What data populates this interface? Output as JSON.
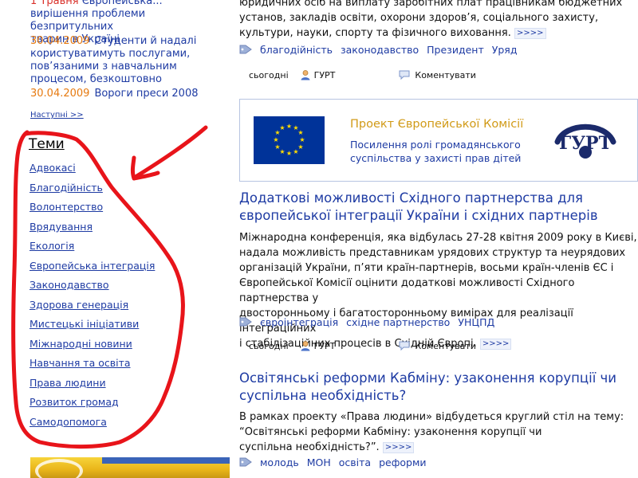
{
  "sidebar": {
    "news_top_1": "Європейська...",
    "news_top_red": "1 Травня",
    "news_top_2": "вирішення проблеми безпритульних",
    "news_top_3": "тварин в Україні",
    "news_items": [
      {
        "date": "30.04.2009",
        "text": "Студенти й надалі користуватимуть послугами, пов’язаними з навчальним процесом, безкоштовно"
      },
      {
        "date": "30.04.2009",
        "text": "Вороги преси 2008"
      }
    ],
    "next_label": "Наступні >>",
    "topics_title": "Теми",
    "topics": [
      "Адвокасі",
      "Благодійність",
      "Волонтерство",
      "Врядування",
      "Екологія",
      "Європейська інтеграція",
      "Законодавство",
      "Здорова генерація",
      "Мистецькі ініціативи",
      "Міжнародні новини",
      "Навчання та освіта",
      "Права людини",
      "Розвиток громад",
      "Самодопомога"
    ]
  },
  "article_top": {
    "text_line1": "юридичних осіб на виплату заробітних плат працівникам бюджетних",
    "text_line2": "установ, закладів освіти, охорони здоров’я, соціального захисту,",
    "text_line3": "культури, науки, спорту та фізичного виховання.",
    "more": ">>>>",
    "tags": [
      "благодійність",
      "законодавство",
      "Президент",
      "Уряд"
    ],
    "meta": {
      "date": "сьогодні",
      "author": "ГУРТ",
      "comment": "Коментувати"
    }
  },
  "banner": {
    "title": "Проект Європейської Комісії",
    "line1": "Посилення ролі громадянського",
    "line2": "суспільства у захисті прав дітей",
    "logo_text": "ГУРТ"
  },
  "article2": {
    "title_line1": "Додаткові можливості Східного партнерства для",
    "title_line2": "європейської інтеграції України і східних партнерів",
    "body_lines": [
      "Міжнародна конференція, яка відбулась 27-28 квітня 2009 року в Києві,",
      "надала можливість представникам урядових структур та неурядових",
      "організацій України, п’яти країн-партнерів, восьми країн-членів ЄС і",
      "Європейської Комісії оцінити додаткові можливості Східного партнерства у",
      "двосторонньому і багатосторонньому вимірах для реалізації інтеграційних",
      "і стабілізаційних процесів в Східній Європі."
    ],
    "more": ">>>>",
    "tags": [
      "євроінтеграція",
      "східне партнерство",
      "УНЦПД"
    ],
    "meta": {
      "date": "сьогодні",
      "author": "ГУРТ",
      "comment": "Коментувати"
    }
  },
  "article3": {
    "title_line1": "Освітянські реформи Кабміну: узаконення корупції чи",
    "title_line2": "суспільна необхідність?",
    "body_lines": [
      "В рамках проекту «Права людини» відбудеться круглий стіл на тему:",
      "“Освітянські реформи Кабміну: узаконення корупції чи",
      "суспільна необхідність?”."
    ],
    "more": ">>>>",
    "tags": [
      "молодь",
      "МОН",
      "освіта",
      "реформи"
    ]
  },
  "colors": {
    "link": "#1e3ba3",
    "date": "#e67a10",
    "annotation": "#e8141a",
    "eu_blue": "#003399",
    "eu_star": "#ffdd00"
  }
}
